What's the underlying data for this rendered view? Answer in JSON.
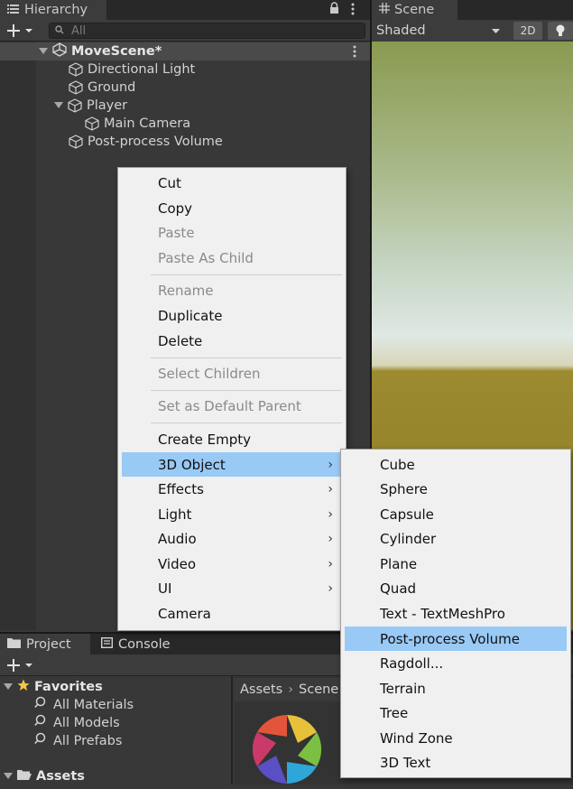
{
  "hierarchy": {
    "tab_label": "Hierarchy",
    "search_placeholder": "All",
    "scene_name": "MoveScene*",
    "items": [
      {
        "label": "Directional Light"
      },
      {
        "label": "Ground"
      },
      {
        "label": "Player"
      },
      {
        "label": "Main Camera"
      },
      {
        "label": "Post-process Volume"
      }
    ]
  },
  "scene_view": {
    "tab_label": "Scene",
    "shading_mode": "Shaded",
    "mode_2d_label": "2D"
  },
  "context_menu": {
    "items": [
      {
        "label": "Cut",
        "enabled": true
      },
      {
        "label": "Copy",
        "enabled": true
      },
      {
        "label": "Paste",
        "enabled": false
      },
      {
        "label": "Paste As Child",
        "enabled": false
      },
      {
        "label": "Rename",
        "enabled": false
      },
      {
        "label": "Duplicate",
        "enabled": true
      },
      {
        "label": "Delete",
        "enabled": true
      },
      {
        "label": "Select Children",
        "enabled": false
      },
      {
        "label": "Set as Default Parent",
        "enabled": false
      },
      {
        "label": "Create Empty",
        "enabled": true
      },
      {
        "label": "3D Object",
        "enabled": true,
        "submenu": true,
        "highlighted": true
      },
      {
        "label": "Effects",
        "enabled": true,
        "submenu": true
      },
      {
        "label": "Light",
        "enabled": true,
        "submenu": true
      },
      {
        "label": "Audio",
        "enabled": true,
        "submenu": true
      },
      {
        "label": "Video",
        "enabled": true,
        "submenu": true
      },
      {
        "label": "UI",
        "enabled": true,
        "submenu": true
      },
      {
        "label": "Camera",
        "enabled": true
      }
    ],
    "arrow_glyph": "›"
  },
  "submenu_3d": {
    "items": [
      {
        "label": "Cube"
      },
      {
        "label": "Sphere"
      },
      {
        "label": "Capsule"
      },
      {
        "label": "Cylinder"
      },
      {
        "label": "Plane"
      },
      {
        "label": "Quad"
      },
      {
        "label": "Text - TextMeshPro"
      },
      {
        "label": "Post-process Volume",
        "highlighted": true
      },
      {
        "label": "Ragdoll..."
      },
      {
        "label": "Terrain"
      },
      {
        "label": "Tree"
      },
      {
        "label": "Wind Zone"
      },
      {
        "label": "3D Text"
      }
    ]
  },
  "project": {
    "tab_label": "Project",
    "console_tab_label": "Console",
    "favorites_label": "Favorites",
    "favorites": [
      {
        "label": "All Materials"
      },
      {
        "label": "All Models"
      },
      {
        "label": "All Prefabs"
      }
    ],
    "assets_label": "Assets",
    "breadcrumb": [
      "Assets",
      "Scene"
    ]
  },
  "colors": {
    "highlight": "#99c9f5",
    "panel_bg": "#383838",
    "menu_bg": "#f0f0f0",
    "favorites_star": "#f4c542"
  }
}
